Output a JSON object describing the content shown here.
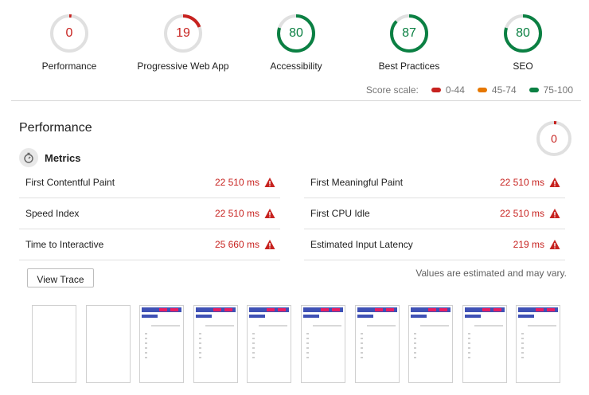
{
  "gauges": [
    {
      "score": "0",
      "label": "Performance",
      "status": "fail",
      "fraction": 0.02
    },
    {
      "score": "19",
      "label": "Progressive Web App",
      "status": "fail",
      "fraction": 0.19
    },
    {
      "score": "80",
      "label": "Accessibility",
      "status": "pass",
      "fraction": 0.8
    },
    {
      "score": "87",
      "label": "Best Practices",
      "status": "pass",
      "fraction": 0.87
    },
    {
      "score": "80",
      "label": "SEO",
      "status": "pass",
      "fraction": 0.8
    }
  ],
  "score_scale": {
    "label": "Score scale:",
    "ranges": [
      {
        "text": "0-44",
        "color": "#c7221f"
      },
      {
        "text": "45-74",
        "color": "#e67700"
      },
      {
        "text": "75-100",
        "color": "#0b8043"
      }
    ]
  },
  "performance": {
    "title": "Performance",
    "score": "0",
    "metrics_title": "Metrics",
    "metrics": [
      {
        "name": "First Contentful Paint",
        "value": "22 510 ms"
      },
      {
        "name": "First Meaningful Paint",
        "value": "22 510 ms"
      },
      {
        "name": "Speed Index",
        "value": "22 510 ms"
      },
      {
        "name": "First CPU Idle",
        "value": "22 510 ms"
      },
      {
        "name": "Time to Interactive",
        "value": "25 660 ms"
      },
      {
        "name": "Estimated Input Latency",
        "value": "219 ms"
      }
    ],
    "view_trace_label": "View Trace",
    "note": "Values are estimated and may vary.",
    "filmstrip_frames": 10,
    "filmstrip_blank_frames": 2
  },
  "colors": {
    "fail": "#c7221f",
    "average": "#e67700",
    "pass": "#0b8043",
    "track": "#e0e0e0"
  }
}
